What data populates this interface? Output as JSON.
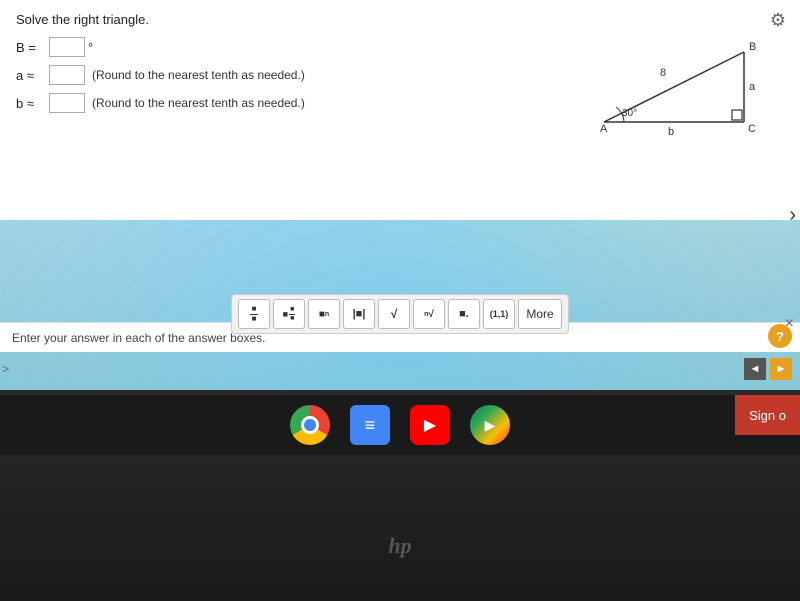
{
  "screen": {
    "bg_color": "#e8f4f8"
  },
  "problem": {
    "title": "Solve the right triangle.",
    "triangle": {
      "angle_a_label": "30°",
      "side_8_label": "8",
      "vertex_A": "A",
      "vertex_B": "B",
      "vertex_C": "C",
      "side_a_label": "a",
      "side_b_label": "b"
    },
    "fields": [
      {
        "label": "B =",
        "input_id": "B",
        "unit": "°",
        "note": ""
      },
      {
        "label": "a ≈",
        "input_id": "a",
        "note": "(Round to the nearest tenth as needed.)"
      },
      {
        "label": "b ≈",
        "input_id": "b",
        "note": "(Round to the nearest tenth as needed.)"
      }
    ]
  },
  "toolbar": {
    "buttons": [
      {
        "id": "frac",
        "symbol": "▪/▪",
        "title": "Fraction"
      },
      {
        "id": "mixed",
        "symbol": "▪▪/▪",
        "title": "Mixed number"
      },
      {
        "id": "super",
        "symbol": "▪ⁿ",
        "title": "Superscript"
      },
      {
        "id": "abs",
        "symbol": "|▪|",
        "title": "Absolute value"
      },
      {
        "id": "sqrt",
        "symbol": "√▪",
        "title": "Square root"
      },
      {
        "id": "nthroot",
        "symbol": "ⁿ√▪",
        "title": "Nth root"
      },
      {
        "id": "decimal",
        "symbol": "▪.",
        "title": "Decimal"
      },
      {
        "id": "ordered",
        "symbol": "(1,1)",
        "title": "Ordered pair"
      },
      {
        "id": "more",
        "symbol": "More",
        "title": "More"
      }
    ],
    "close_label": "×"
  },
  "status_bar": {
    "text": "Enter your answer in each of the answer boxes."
  },
  "help_btn_label": "?",
  "nav": {
    "prev_label": "◄",
    "next_label": "►"
  },
  "expand_label": ">",
  "taskbar": {
    "icons": [
      {
        "id": "chrome",
        "label": "Chrome"
      },
      {
        "id": "files",
        "label": "Files"
      },
      {
        "id": "youtube",
        "label": "YouTube"
      },
      {
        "id": "playstore",
        "label": "Play Store"
      }
    ]
  },
  "sign_out_label": "Sign o",
  "hp_logo": "hp",
  "gear_icon_label": "⚙",
  "scroll_right_label": "›"
}
